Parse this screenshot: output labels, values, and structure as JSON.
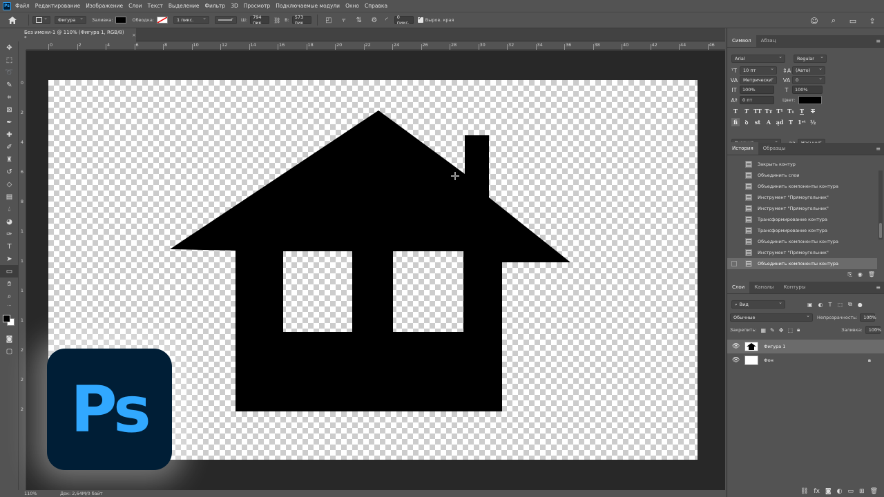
{
  "menu": [
    "Файл",
    "Редактирование",
    "Изображение",
    "Слои",
    "Текст",
    "Выделение",
    "Фильтр",
    "3D",
    "Просмотр",
    "Подключаемые модули",
    "Окно",
    "Справка"
  ],
  "app_icon_text": "Ps",
  "options": {
    "shape_mode": "Фигура",
    "fill_label": "Заливка:",
    "stroke_label": "Обводка:",
    "stroke_width": "1 пикс.",
    "w_label": "Ш:",
    "w_value": "794 пик",
    "h_label": "В:",
    "h_value": "573 пик",
    "radius_value": "0 пикс.",
    "align_edges": "Выров. края",
    "fill_color": "#000000"
  },
  "document": {
    "tab_title": "Без имени-1 @ 110% (Фигура 1, RGB/8) *",
    "close": "×"
  },
  "ruler_h": [
    "0",
    "2",
    "4",
    "6",
    "8",
    "10",
    "12",
    "14",
    "16",
    "18",
    "20",
    "22",
    "24",
    "26",
    "28",
    "30",
    "32",
    "34",
    "36",
    "38",
    "40",
    "42",
    "44",
    "46"
  ],
  "ruler_v": [
    "0",
    "2",
    "4",
    "6",
    "8",
    "1",
    "1",
    "1",
    "1",
    "2",
    "2",
    "2"
  ],
  "logo_text": "Ps",
  "status": {
    "zoom": "110%",
    "info": "Док: 2,64M/0 байт"
  },
  "character": {
    "tabs": [
      "Символ",
      "Абзац"
    ],
    "font_family": "Arial",
    "font_style": "Regular",
    "size": "10 пт",
    "leading": "(Авто)",
    "kerning": "Метрически",
    "tracking": "0",
    "vscale": "100%",
    "hscale": "100%",
    "baseline": "0 пт",
    "color_label": "Цвет:",
    "language": "Русский",
    "antialias": "Насыще..."
  },
  "history": {
    "tabs": [
      "История",
      "Образцы"
    ],
    "items": [
      "Закрыть контур",
      "Объединить слои",
      "Объединить компоненты контура",
      "Инструмент \"Прямоугольник\"",
      "Инструмент \"Прямоугольник\"",
      "Трансформирование контура",
      "Трансформирование контура",
      "Объединить компоненты контура",
      "Инструмент \"Прямоугольник\"",
      "Объединить компоненты контура"
    ]
  },
  "layers": {
    "tabs": [
      "Слои",
      "Каналы",
      "Контуры"
    ],
    "filter": "Вид",
    "blend": "Обычные",
    "opacity_label": "Непрозрачность:",
    "opacity": "100%",
    "lock_label": "Закрепить:",
    "fill_label": "Заливка:",
    "fill": "100%",
    "items": [
      "Фигура 1",
      "Фон"
    ]
  }
}
